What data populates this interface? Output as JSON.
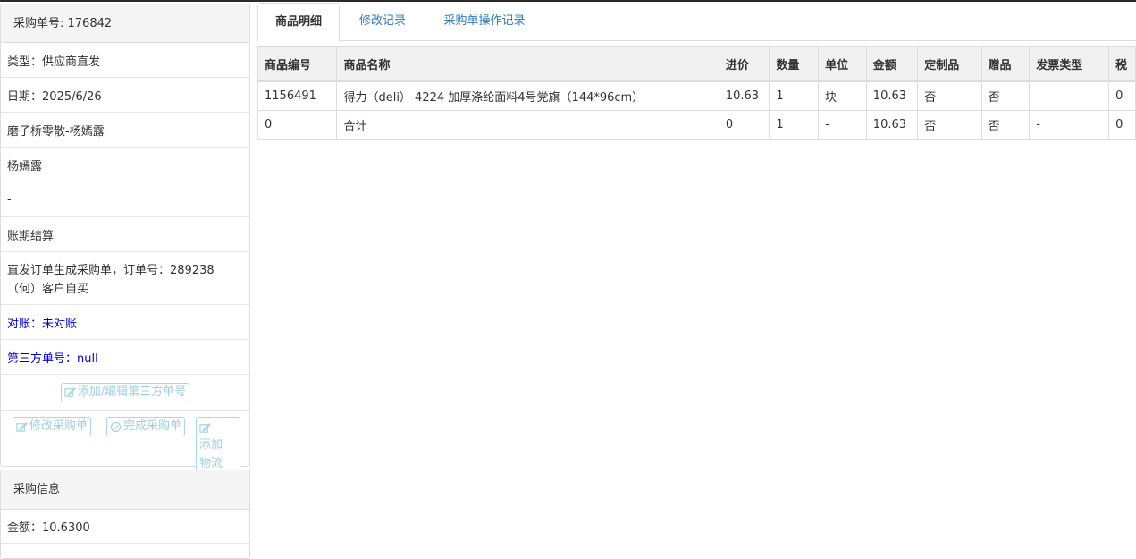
{
  "order_panel": {
    "header": "采购单号: 176842",
    "type": "类型：供应商直发",
    "date": "日期：2025/6/26",
    "customer": "磨子桥零散-杨嫣露",
    "contact": "杨嫣露",
    "dash": "-",
    "settlement": "账期结算",
    "note": "直发订单生成采购单，订单号：289238（何）客户自买",
    "reconcile": "对账：未对账",
    "third_party": "第三方单号：null",
    "btn_add_third": "添加/编辑第三方单号",
    "btn_modify": "修改采购单",
    "btn_complete": "完成采购单",
    "btn_logistics": "添加物流"
  },
  "purchase_info": {
    "header": "采购信息",
    "amount": "金额：10.6300"
  },
  "tabs": [
    "商品明细",
    "修改记录",
    "采购单操作记录"
  ],
  "table": {
    "headers": [
      "商品编号",
      "商品名称",
      "进价",
      "数量",
      "单位",
      "金额",
      "定制品",
      "赠品",
      "发票类型",
      "税"
    ],
    "rows": [
      [
        "1156491",
        "得力（deli） 4224 加厚涤纶面料4号党旗（144*96cm）",
        "10.63",
        "1",
        "块",
        "10.63",
        "否",
        "否",
        "",
        "0"
      ],
      [
        "0",
        "合计",
        "0",
        "1",
        "-",
        "10.63",
        "否",
        "否",
        "-",
        "0"
      ]
    ]
  },
  "colors": {
    "link": "#337ab7",
    "blue_text": "#0000cc",
    "outline_button": "#9fd0e2"
  }
}
